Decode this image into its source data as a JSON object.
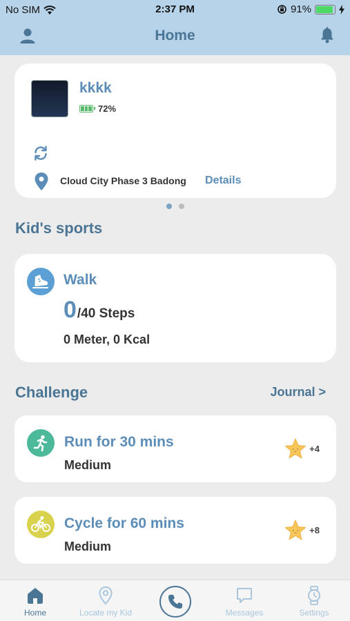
{
  "status_bar": {
    "carrier": "No SIM",
    "time": "2:37 PM",
    "battery": "91%",
    "battery_level": 0.91
  },
  "header": {
    "title": "Home",
    "left_icon": "user-icon",
    "right_icon": "bell-icon"
  },
  "device": {
    "name": "kkkk",
    "battery": "72%",
    "address": "Cloud City Phase 3 Badong",
    "details_label": "Details"
  },
  "pager": {
    "count": 2,
    "active": 0
  },
  "sports": {
    "section_title": "Kid's sports",
    "activity": "Walk",
    "steps_current": "0",
    "steps_goal": "/40 Steps",
    "summary": "0 Meter, 0 Kcal"
  },
  "challenge": {
    "section_title": "Challenge",
    "journal_label": "Journal >",
    "items": [
      {
        "title": "Run for 30 mins",
        "level": "Medium",
        "reward": "+4",
        "icon": "run-icon",
        "color": "#4cb99a"
      },
      {
        "title": "Cycle for 60 mins",
        "level": "Medium",
        "reward": "+8",
        "icon": "bicycle-icon",
        "color": "#d9d24f"
      }
    ]
  },
  "tabbar": {
    "items": [
      {
        "label": "Home",
        "icon": "home-icon",
        "active": true
      },
      {
        "label": "Locate my Kid",
        "icon": "location-icon",
        "active": false
      },
      {
        "label": "",
        "icon": "phone-icon",
        "active": false
      },
      {
        "label": "Messages",
        "icon": "chat-icon",
        "active": false
      },
      {
        "label": "Settings",
        "icon": "watch-icon",
        "active": false
      }
    ]
  },
  "colors": {
    "header_bg": "#b6d3ea",
    "accent": "#4b7594",
    "link": "#5b8db8",
    "page_bg": "#ececec"
  }
}
